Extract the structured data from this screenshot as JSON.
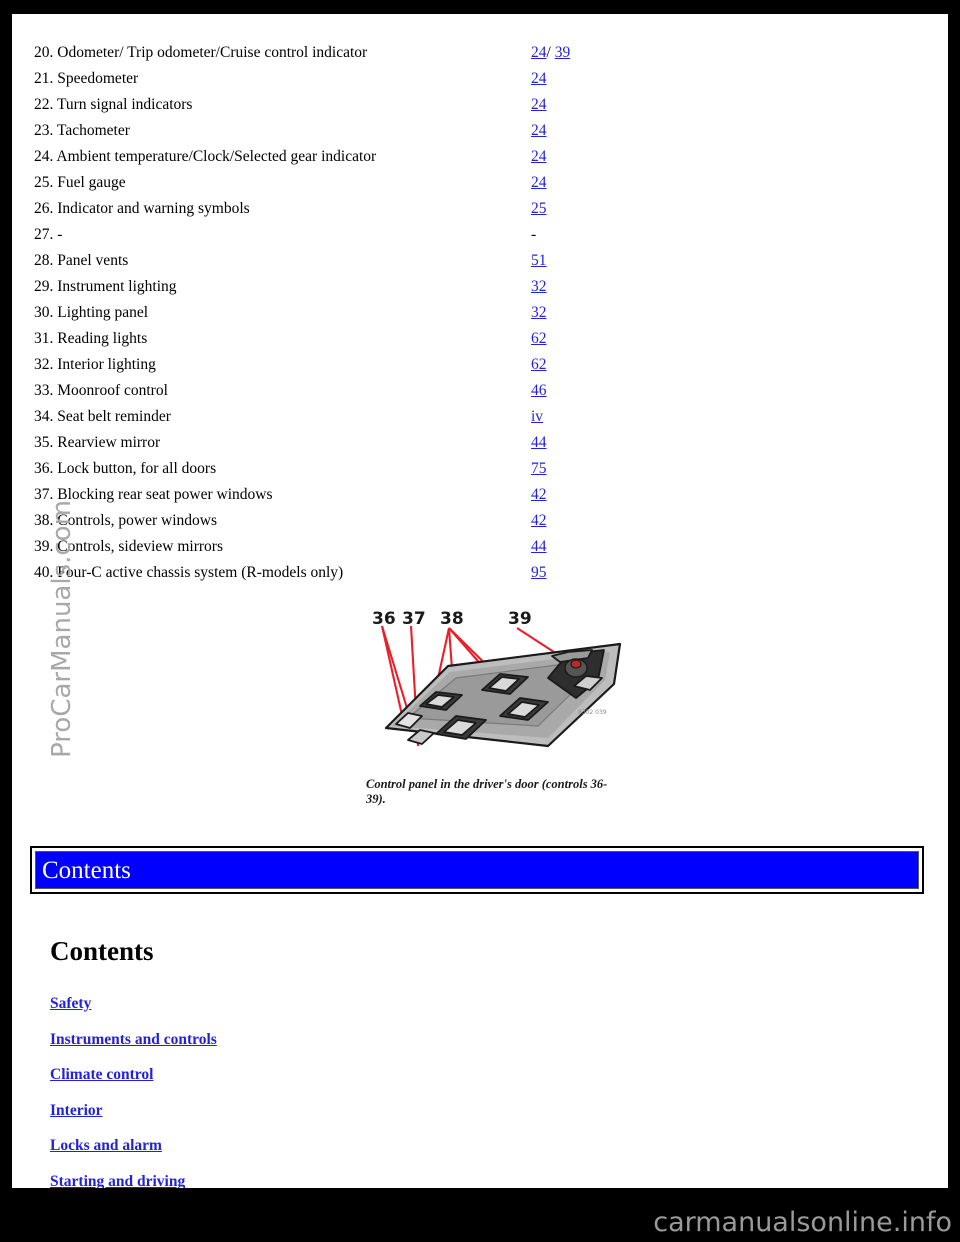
{
  "document": {
    "side_watermark": "ProCarManuals.com",
    "footer_watermark": "carmanualsonline.info"
  },
  "index_list": [
    {
      "label": "20. Odometer/ Trip odometer/Cruise control indicator",
      "pages": [
        "24",
        "39"
      ],
      "separator": "/ "
    },
    {
      "label": "21. Speedometer",
      "pages": [
        "24"
      ]
    },
    {
      "label": "22. Turn signal indicators",
      "pages": [
        "24"
      ]
    },
    {
      "label": "23. Tachometer",
      "pages": [
        "24"
      ]
    },
    {
      "label": "24. Ambient temperature/Clock/Selected gear indicator",
      "pages": [
        "24"
      ]
    },
    {
      "label": "25. Fuel gauge",
      "pages": [
        "24"
      ]
    },
    {
      "label": "26. Indicator and warning symbols",
      "pages": [
        "25"
      ]
    },
    {
      "label": "27. -",
      "pages": [
        "-"
      ],
      "plain": true
    },
    {
      "label": "28. Panel vents",
      "pages": [
        "51"
      ]
    },
    {
      "label": "29. Instrument lighting",
      "pages": [
        "32"
      ]
    },
    {
      "label": "30. Lighting panel",
      "pages": [
        "32"
      ]
    },
    {
      "label": "31. Reading lights",
      "pages": [
        "62"
      ]
    },
    {
      "label": "32. Interior lighting",
      "pages": [
        "62"
      ]
    },
    {
      "label": "33. Moonroof control",
      "pages": [
        "46"
      ]
    },
    {
      "label": "34. Seat belt reminder",
      "pages": [
        "iv"
      ]
    },
    {
      "label": "35. Rearview mirror",
      "pages": [
        "44"
      ]
    },
    {
      "label": "36. Lock button, for all doors",
      "pages": [
        "75"
      ]
    },
    {
      "label": "37. Blocking rear seat power windows",
      "pages": [
        "42"
      ]
    },
    {
      "label": "38. Controls, power windows",
      "pages": [
        "42"
      ]
    },
    {
      "label": "39. Controls, sideview mirrors",
      "pages": [
        "44"
      ]
    },
    {
      "label": "40. Four-C active chassis system (R-models only)",
      "pages": [
        "95"
      ]
    }
  ],
  "illustration": {
    "caption": "Control panel in the driver's door (controls 36-39).",
    "callouts": [
      "36",
      "37",
      "38",
      "39"
    ],
    "callout_color": "#e8202a"
  },
  "contents_banner": {
    "title": "Contents"
  },
  "contents_section": {
    "heading": "Contents",
    "links": [
      "Safety",
      "Instruments and controls",
      "Climate control",
      "Interior",
      "Locks and alarm",
      "Starting and driving"
    ]
  }
}
